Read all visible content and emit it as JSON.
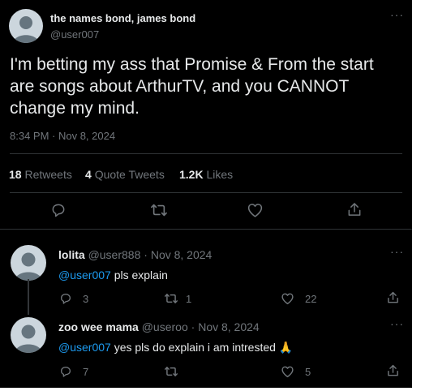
{
  "tweet": {
    "display_name": "the names bond, james bond",
    "handle": "@user007",
    "text": "I'm betting my ass that Promise & From the start are songs about ArthurTV, and you CANNOT change my mind.",
    "timestamp": "8:34 PM · Nov 8, 2024",
    "stats": {
      "retweets_count": "18",
      "retweets_label": "Retweets",
      "quotes_count": "4",
      "quotes_label": "Quote Tweets",
      "likes_count": "1.2K",
      "likes_label": "Likes"
    },
    "more_icon": "more-dots-icon"
  },
  "actions": {
    "icons": [
      "reply-icon",
      "retweet-icon",
      "like-icon",
      "share-icon"
    ]
  },
  "replies": [
    {
      "display_name": "lolita",
      "handle": "@user888",
      "separator": "·",
      "date": "Nov 8, 2024",
      "mention": "@user007",
      "text": " pls explain",
      "emoji": "",
      "reply_count": "3",
      "retweet_count": "1",
      "like_count": "22"
    },
    {
      "display_name": "zoo wee mama",
      "handle": "@useroo",
      "separator": "·",
      "date": "Nov 8, 2024",
      "mention": "@user007",
      "text": " yes pls do explain i am intrested ",
      "emoji": "🙏",
      "reply_count": "7",
      "retweet_count": "",
      "like_count": "5"
    }
  ],
  "colors": {
    "background": "#000000",
    "text": "#e7e9ea",
    "muted": "#71767b",
    "link": "#1d9bf0",
    "divider": "#2f3336"
  }
}
